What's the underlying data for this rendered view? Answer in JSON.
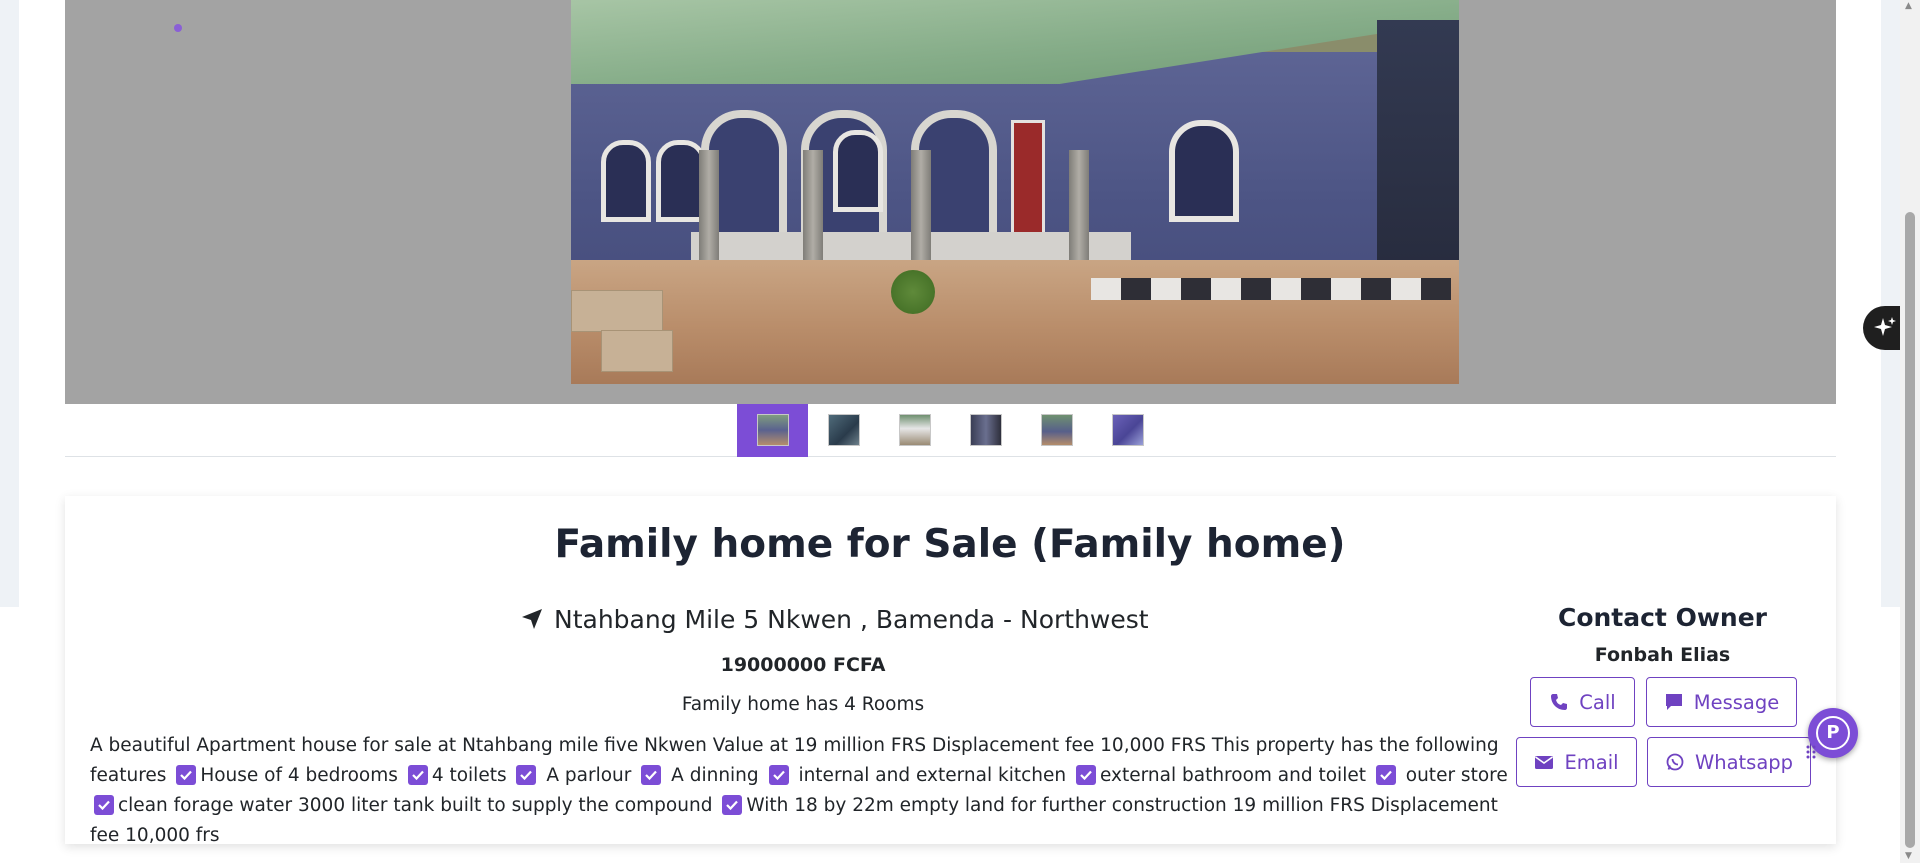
{
  "listing": {
    "title": "Family home for Sale (Family home)",
    "location": "Ntahbang Mile 5 Nkwen , Bamenda - Northwest",
    "price": "19000000 FCFA",
    "rooms": "Family home has 4 Rooms",
    "description_intro": "A beautiful Apartment house for sale at Ntahbang mile five Nkwen Value at 19 million FRS Displacement fee 10,000 FRS This property has the following features",
    "features": [
      "House of 4 bedrooms",
      "4 toilets",
      "A parlour",
      "A dinning",
      "internal and external kitchen",
      "external bathroom and toilet",
      "outer store",
      "clean forage water 3000 liter tank built to supply the compound",
      "With 18 by 22m empty land for further construction 19 million FRS Displacement fee 10,000 frs"
    ]
  },
  "contact": {
    "heading": "Contact Owner",
    "owner_name": "Fonbah Elias",
    "buttons": {
      "call": "Call",
      "message": "Message",
      "email": "Email",
      "whatsapp": "Whatsapp"
    }
  },
  "gallery": {
    "thumbnail_count": 6,
    "active_thumbnail": 1
  },
  "colors": {
    "accent": "#7c4dd6",
    "button_border": "#6f42c1",
    "gallery_bg": "#a3a3a3",
    "title_text": "#1d2433"
  },
  "icons": [
    "location-arrow-icon",
    "check-icon",
    "phone-icon",
    "message-icon",
    "envelope-icon",
    "whatsapp-icon",
    "sparkle-icon",
    "plugin-p-icon"
  ]
}
